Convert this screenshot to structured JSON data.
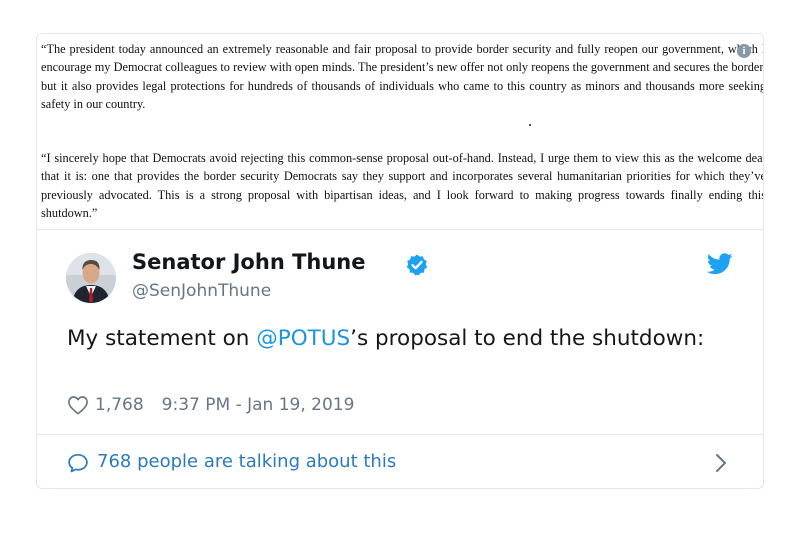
{
  "statement": {
    "paragraph1": "“The president today announced an extremely reasonable and fair proposal to provide border security and fully reopen our government, which I encourage my Democrat colleagues to review with open minds. The president’s new offer not only reopens the government and secures the border, but it also provides legal protections for hundreds of thousands of individuals who came to this country as minors and thousands more seeking safety in our country.",
    "paragraph2": "“I sincerely hope that Democrats avoid rejecting this common-sense proposal out-of-hand. Instead, I urge them to view this as the welcome deal that it is: one that provides the border security Democrats say they support and incorporates several humanitarian priorities for which they’ve previously advocated. This is a strong proposal with bipartisan ideas, and I look forward to making progress towards finally ending this shutdown.”",
    "info_glyph": "i"
  },
  "tweet": {
    "author_name": "Senator John Thune",
    "handle": "@SenJohnThune",
    "text_before": "My statement on ",
    "mention": "@POTUS",
    "text_after": "’s proposal to end the shutdown:",
    "like_count": "1,768",
    "timestamp": "9:37 PM - Jan 19, 2019",
    "talking_label": "768 people are talking about this"
  },
  "icons": {
    "info": "info-icon",
    "verified": "verified-badge-icon",
    "brand": "twitter-bird-icon",
    "like": "heart-icon",
    "reply": "speech-bubble-icon",
    "chevron": "chevron-right-icon"
  },
  "colors": {
    "link": "#1b95e0",
    "verified": "#1da1f2",
    "muted": "#657786",
    "talking": "#2b7bb9"
  }
}
